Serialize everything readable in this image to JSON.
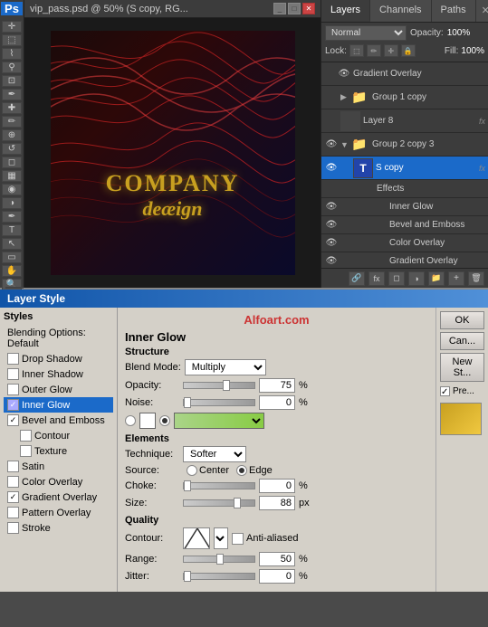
{
  "app": {
    "name": "Ps",
    "canvas_title": "vip_pass.psd @ 50% (S copy, RG...",
    "canvas_zoom": "50%"
  },
  "panels": {
    "tabs": [
      {
        "label": "Layers",
        "active": true
      },
      {
        "label": "Channels",
        "active": false
      },
      {
        "label": "Paths",
        "active": false
      }
    ]
  },
  "layers_panel": {
    "blend_mode": "Normal",
    "opacity_label": "Opacity:",
    "opacity_value": "100%",
    "lock_label": "Lock:",
    "fill_label": "Fill:",
    "fill_value": "100%",
    "layers": [
      {
        "name": "Gradient Overlay",
        "type": "effect",
        "visible": true,
        "indent": 1
      },
      {
        "name": "Group 1 copy",
        "type": "group",
        "visible": false,
        "indent": 0
      },
      {
        "name": "Layer 8",
        "type": "layer",
        "visible": false,
        "indent": 0,
        "fx": true
      },
      {
        "name": "Group 2 copy 3",
        "type": "group",
        "visible": true,
        "indent": 0
      },
      {
        "name": "S copy",
        "type": "text",
        "visible": true,
        "selected": true,
        "indent": 1,
        "fx": true
      },
      {
        "name": "Effects",
        "type": "effects-header",
        "visible": false,
        "indent": 1
      },
      {
        "name": "Inner Glow",
        "type": "effect",
        "visible": true,
        "indent": 2
      },
      {
        "name": "Bevel and Emboss",
        "type": "effect",
        "visible": true,
        "indent": 2
      },
      {
        "name": "Color Overlay",
        "type": "effect",
        "visible": true,
        "indent": 2
      },
      {
        "name": "Gradient Overlay",
        "type": "effect",
        "visible": true,
        "indent": 2
      }
    ]
  },
  "dialog": {
    "title": "Layer Style",
    "site_label": "Alfoart.com",
    "styles_title": "Styles",
    "styles": [
      {
        "label": "Blending Options: Default",
        "checked": false,
        "active": false
      },
      {
        "label": "Drop Shadow",
        "checked": false,
        "active": false
      },
      {
        "label": "Inner Shadow",
        "checked": false,
        "active": false
      },
      {
        "label": "Outer Glow",
        "checked": false,
        "active": false
      },
      {
        "label": "Inner Glow",
        "checked": true,
        "active": true
      },
      {
        "label": "Bevel and Emboss",
        "checked": true,
        "active": false
      },
      {
        "label": "Contour",
        "checked": false,
        "active": false
      },
      {
        "label": "Texture",
        "checked": false,
        "active": false
      },
      {
        "label": "Satin",
        "checked": false,
        "active": false
      },
      {
        "label": "Color Overlay",
        "checked": false,
        "active": false
      },
      {
        "label": "Gradient Overlay",
        "checked": true,
        "active": false
      },
      {
        "label": "Pattern Overlay",
        "checked": false,
        "active": false
      },
      {
        "label": "Stroke",
        "checked": false,
        "active": false
      }
    ],
    "inner_glow": {
      "section": "Inner Glow",
      "structure_header": "Structure",
      "blend_mode_label": "Blend Mode:",
      "blend_mode": "Multiply",
      "opacity_label": "Opacity:",
      "opacity_value": "75",
      "opacity_unit": "%",
      "noise_label": "Noise:",
      "noise_value": "0",
      "noise_unit": "%",
      "elements_header": "Elements",
      "technique_label": "Technique:",
      "technique": "Softer",
      "source_label": "Source:",
      "source_center": "Center",
      "source_edge": "Edge",
      "source_selected": "Edge",
      "choke_label": "Choke:",
      "choke_value": "0",
      "choke_unit": "%",
      "size_label": "Size:",
      "size_value": "88",
      "size_unit": "px",
      "quality_header": "Quality",
      "contour_label": "Contour:",
      "anti_aliased_label": "Anti-aliased",
      "range_label": "Range:",
      "range_value": "50",
      "range_unit": "%",
      "jitter_label": "Jitter:",
      "jitter_value": "0",
      "jitter_unit": "%"
    },
    "buttons": {
      "ok": "OK",
      "cancel": "Can...",
      "new_style": "New St...",
      "preview": "Pre..."
    }
  },
  "canvas": {
    "company_text": "COMPANY",
    "design_text": "deæign"
  }
}
